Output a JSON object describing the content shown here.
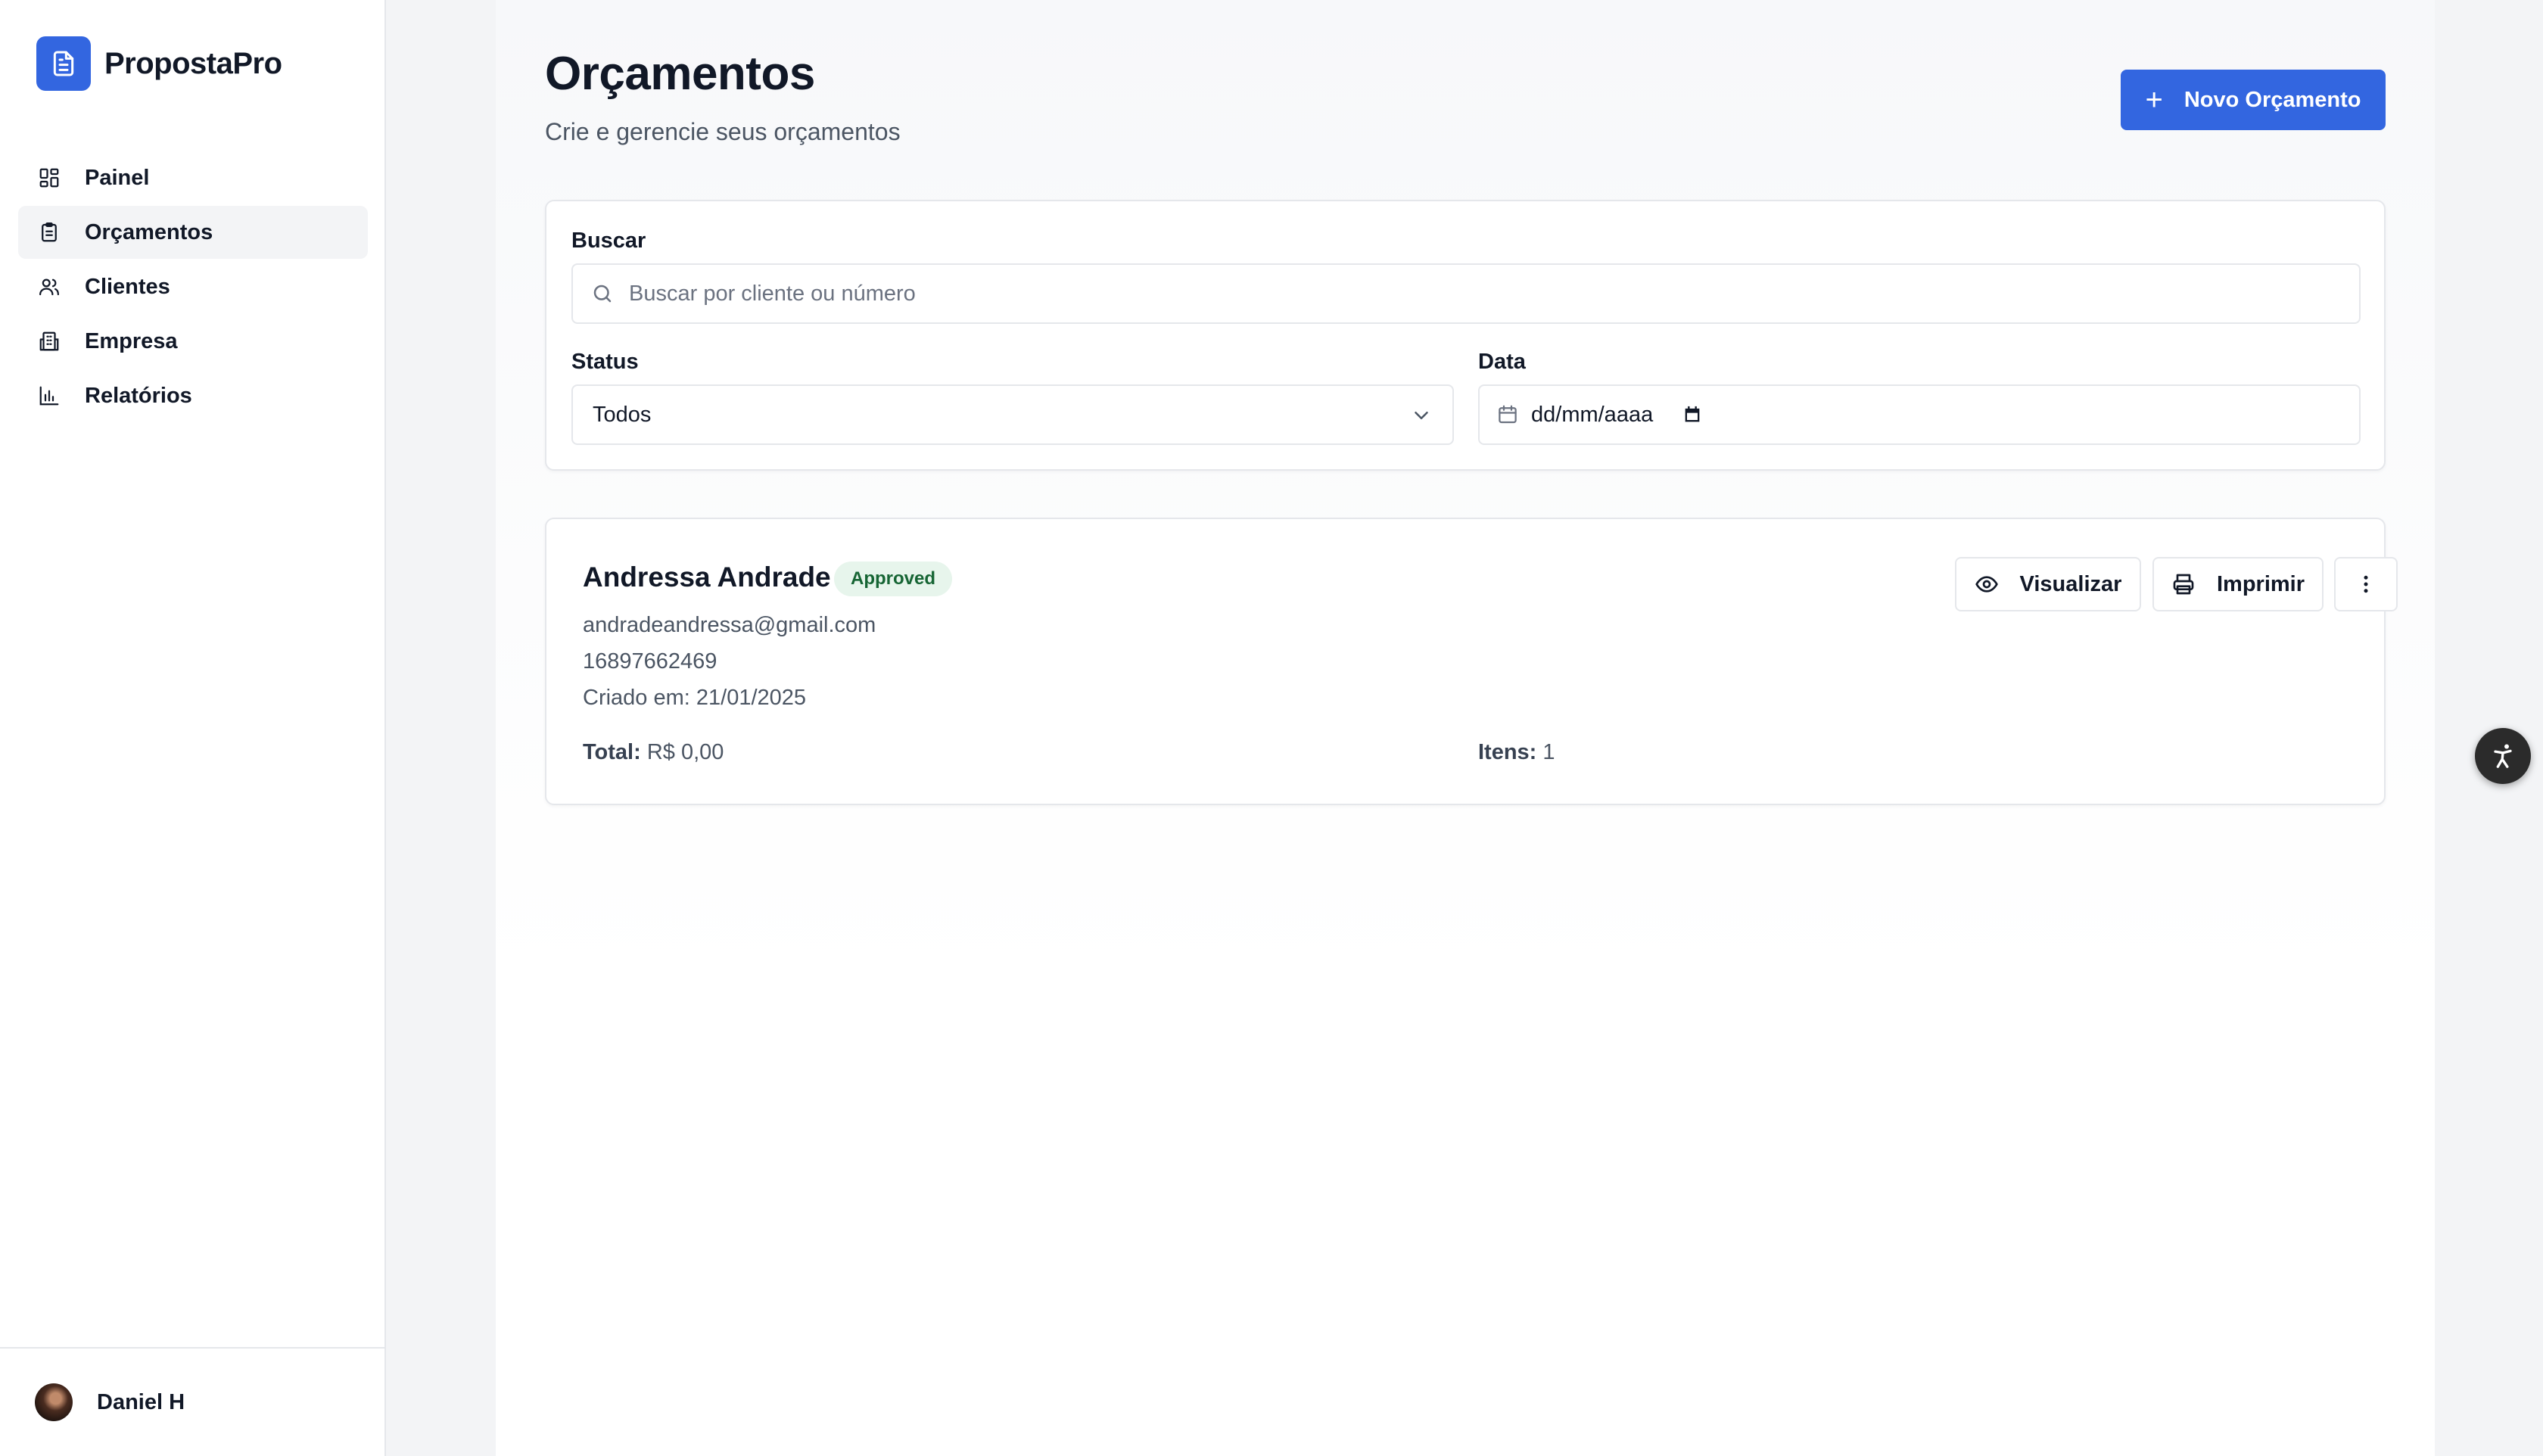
{
  "brand": {
    "name": "PropostaPro",
    "accent": "#3366e0"
  },
  "sidebar": {
    "items": [
      {
        "label": "Painel",
        "icon": "dashboard-icon",
        "active": false
      },
      {
        "label": "Orçamentos",
        "icon": "clipboard-icon",
        "active": true
      },
      {
        "label": "Clientes",
        "icon": "users-icon",
        "active": false
      },
      {
        "label": "Empresa",
        "icon": "building-icon",
        "active": false
      },
      {
        "label": "Relatórios",
        "icon": "bar-chart-icon",
        "active": false
      }
    ],
    "user": {
      "name": "Daniel H"
    }
  },
  "header": {
    "title": "Orçamentos",
    "subtitle": "Crie e gerencie seus orçamentos",
    "new_button": "Novo Orçamento"
  },
  "filters": {
    "search_label": "Buscar",
    "search_placeholder": "Buscar por cliente ou número",
    "status_label": "Status",
    "status_value": "Todos",
    "date_label": "Data",
    "date_placeholder": "dd/mm/aaaa"
  },
  "quotes": [
    {
      "client": "Andressa Andrade",
      "status": "Approved",
      "email": "andradeandressa@gmail.com",
      "phone": "16897662469",
      "created": "Criado em: 21/01/2025",
      "total_label": "Total:",
      "total_value": "R$ 0,00",
      "items_label": "Itens:",
      "items_value": "1",
      "view_label": "Visualizar",
      "print_label": "Imprimir"
    }
  ],
  "colors": {
    "primary": "#3366e0",
    "badge_bg": "#e7f5ec",
    "badge_text": "#166534"
  }
}
